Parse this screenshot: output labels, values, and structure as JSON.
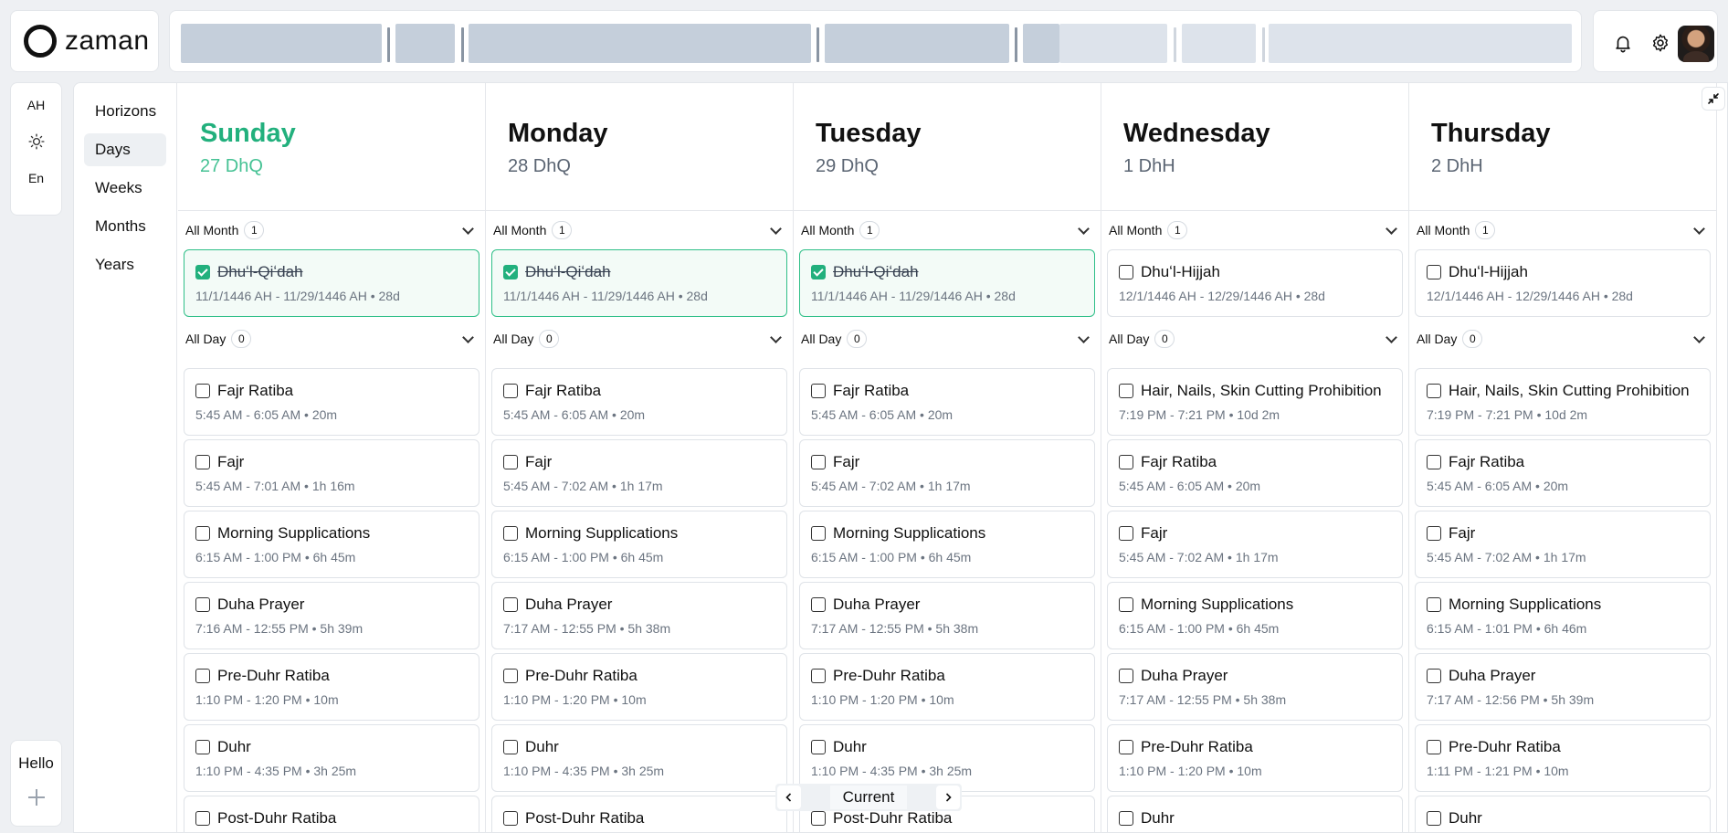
{
  "brand": {
    "name": "zaman"
  },
  "rail": {
    "calendar": "AH",
    "language": "En"
  },
  "footer_rail": {
    "hello": "Hello"
  },
  "nav": {
    "items": [
      {
        "label": "Horizons"
      },
      {
        "label": "Days",
        "active": true
      },
      {
        "label": "Weeks"
      },
      {
        "label": "Months"
      },
      {
        "label": "Years"
      }
    ]
  },
  "pager": {
    "label": "Current"
  },
  "colors": {
    "accent": "#22b07d",
    "today_date": "#46c294"
  },
  "days": [
    {
      "name": "Sunday",
      "date": "27 DhQ",
      "today": true,
      "all_month": {
        "label": "All Month",
        "count": "1"
      },
      "month_card": {
        "title": "Dhuʻl-Qiʻdah",
        "sub": "11/1/1446 AH - 11/29/1446 AH • 28d",
        "done": true
      },
      "all_day": {
        "label": "All Day",
        "count": "0"
      },
      "events": [
        {
          "title": "Fajr Ratiba",
          "sub": "5:45 AM - 6:05 AM • 20m"
        },
        {
          "title": "Fajr",
          "sub": "5:45 AM - 7:01 AM • 1h 16m"
        },
        {
          "title": "Morning Supplications",
          "sub": "6:15 AM - 1:00 PM • 6h 45m"
        },
        {
          "title": "Duha Prayer",
          "sub": "7:16 AM - 12:55 PM • 5h 39m"
        },
        {
          "title": "Pre-Duhr Ratiba",
          "sub": "1:10 PM - 1:20 PM • 10m"
        },
        {
          "title": "Duhr",
          "sub": "1:10 PM - 4:35 PM • 3h 25m"
        },
        {
          "title": "Post-Duhr Ratiba",
          "sub": ""
        }
      ]
    },
    {
      "name": "Monday",
      "date": "28 DhQ",
      "today": false,
      "all_month": {
        "label": "All Month",
        "count": "1"
      },
      "month_card": {
        "title": "Dhuʻl-Qiʻdah",
        "sub": "11/1/1446 AH - 11/29/1446 AH • 28d",
        "done": true
      },
      "all_day": {
        "label": "All Day",
        "count": "0"
      },
      "events": [
        {
          "title": "Fajr Ratiba",
          "sub": "5:45 AM - 6:05 AM • 20m"
        },
        {
          "title": "Fajr",
          "sub": "5:45 AM - 7:02 AM • 1h 17m"
        },
        {
          "title": "Morning Supplications",
          "sub": "6:15 AM - 1:00 PM • 6h 45m"
        },
        {
          "title": "Duha Prayer",
          "sub": "7:17 AM - 12:55 PM • 5h 38m"
        },
        {
          "title": "Pre-Duhr Ratiba",
          "sub": "1:10 PM - 1:20 PM • 10m"
        },
        {
          "title": "Duhr",
          "sub": "1:10 PM - 4:35 PM • 3h 25m"
        },
        {
          "title": "Post-Duhr Ratiba",
          "sub": ""
        }
      ]
    },
    {
      "name": "Tuesday",
      "date": "29 DhQ",
      "today": false,
      "all_month": {
        "label": "All Month",
        "count": "1"
      },
      "month_card": {
        "title": "Dhuʻl-Qiʻdah",
        "sub": "11/1/1446 AH - 11/29/1446 AH • 28d",
        "done": true
      },
      "all_day": {
        "label": "All Day",
        "count": "0"
      },
      "events": [
        {
          "title": "Fajr Ratiba",
          "sub": "5:45 AM - 6:05 AM • 20m"
        },
        {
          "title": "Fajr",
          "sub": "5:45 AM - 7:02 AM • 1h 17m"
        },
        {
          "title": "Morning Supplications",
          "sub": "6:15 AM - 1:00 PM • 6h 45m"
        },
        {
          "title": "Duha Prayer",
          "sub": "7:17 AM - 12:55 PM • 5h 38m"
        },
        {
          "title": "Pre-Duhr Ratiba",
          "sub": "1:10 PM - 1:20 PM • 10m"
        },
        {
          "title": "Duhr",
          "sub": "1:10 PM - 4:35 PM • 3h 25m"
        },
        {
          "title": "Post-Duhr Ratiba",
          "sub": ""
        }
      ]
    },
    {
      "name": "Wednesday",
      "date": "1 DhH",
      "today": false,
      "all_month": {
        "label": "All Month",
        "count": "1"
      },
      "month_card": {
        "title": "Dhuʻl-Hijjah",
        "sub": "12/1/1446 AH - 12/29/1446 AH • 28d",
        "done": false
      },
      "all_day": {
        "label": "All Day",
        "count": "0"
      },
      "events": [
        {
          "title": "Hair, Nails, Skin Cutting Prohibition",
          "sub": "7:19 PM - 7:21 PM • 10d 2m"
        },
        {
          "title": "Fajr Ratiba",
          "sub": "5:45 AM - 6:05 AM • 20m"
        },
        {
          "title": "Fajr",
          "sub": "5:45 AM - 7:02 AM • 1h 17m"
        },
        {
          "title": "Morning Supplications",
          "sub": "6:15 AM - 1:00 PM • 6h 45m"
        },
        {
          "title": "Duha Prayer",
          "sub": "7:17 AM - 12:55 PM • 5h 38m"
        },
        {
          "title": "Pre-Duhr Ratiba",
          "sub": "1:10 PM - 1:20 PM • 10m"
        },
        {
          "title": "Duhr",
          "sub": ""
        }
      ]
    },
    {
      "name": "Thursday",
      "date": "2 DhH",
      "today": false,
      "all_month": {
        "label": "All Month",
        "count": "1"
      },
      "month_card": {
        "title": "Dhuʻl-Hijjah",
        "sub": "12/1/1446 AH - 12/29/1446 AH • 28d",
        "done": false
      },
      "all_day": {
        "label": "All Day",
        "count": "0"
      },
      "events": [
        {
          "title": "Hair, Nails, Skin Cutting Prohibition",
          "sub": "7:19 PM - 7:21 PM • 10d 2m"
        },
        {
          "title": "Fajr Ratiba",
          "sub": "5:45 AM - 6:05 AM • 20m"
        },
        {
          "title": "Fajr",
          "sub": "5:45 AM - 7:02 AM • 1h 17m"
        },
        {
          "title": "Morning Supplications",
          "sub": "6:15 AM - 1:01 PM • 6h 46m"
        },
        {
          "title": "Duha Prayer",
          "sub": "7:17 AM - 12:56 PM • 5h 39m"
        },
        {
          "title": "Pre-Duhr Ratiba",
          "sub": "1:11 PM - 1:21 PM • 10m"
        },
        {
          "title": "Duhr",
          "sub": ""
        }
      ]
    }
  ]
}
